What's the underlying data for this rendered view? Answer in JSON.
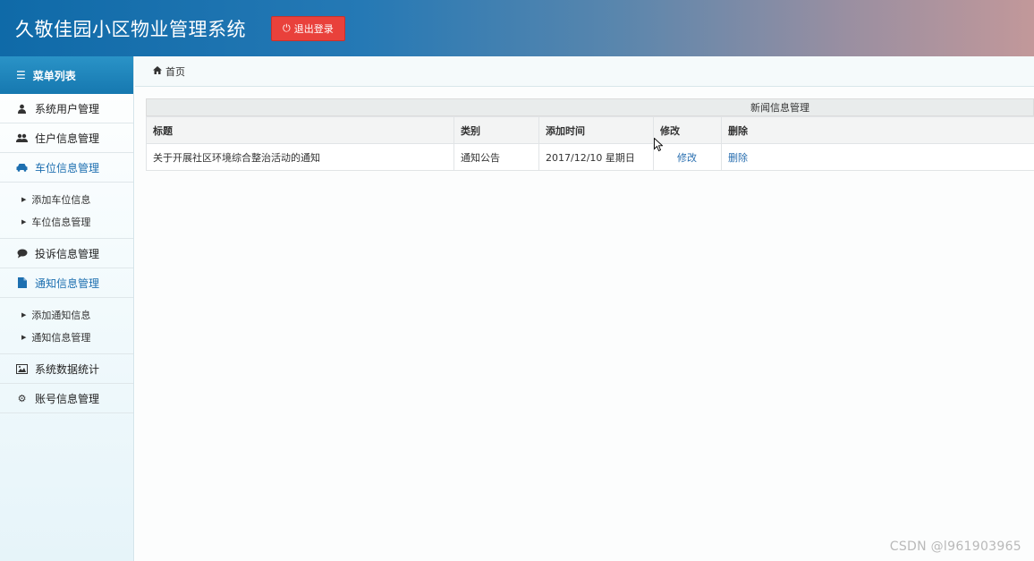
{
  "header": {
    "title": "久敬佳园小区物业管理系统",
    "logout_label": "退出登录"
  },
  "sidebar": {
    "menu_title": "菜单列表",
    "items": [
      {
        "label": "系统用户管理",
        "icon": "user-icon"
      },
      {
        "label": "住户信息管理",
        "icon": "users-icon"
      },
      {
        "label": "车位信息管理",
        "icon": "car-icon",
        "active": true
      },
      {
        "label": "投诉信息管理",
        "icon": "comment-icon"
      },
      {
        "label": "通知信息管理",
        "icon": "file-icon",
        "active": true
      },
      {
        "label": "系统数据统计",
        "icon": "picture-icon"
      },
      {
        "label": "账号信息管理",
        "icon": "gear-icon"
      }
    ],
    "parking_sub": [
      "添加车位信息",
      "车位信息管理"
    ],
    "notice_sub": [
      "添加通知信息",
      "通知信息管理"
    ]
  },
  "breadcrumb": {
    "home": "首页"
  },
  "panel": {
    "title": "新闻信息管理",
    "columns": [
      "标题",
      "类别",
      "添加时间",
      "修改",
      "删除"
    ],
    "rows": [
      {
        "title": "关于开展社区环境综合整治活动的通知",
        "category": "通知公告",
        "time": "2017/12/10 星期日",
        "edit": "修改",
        "delete": "删除"
      }
    ]
  },
  "watermark": "CSDN @l961903965",
  "colors": {
    "header_start": "#0f6aa8",
    "header_end": "#c2989a",
    "accent": "#1d6fb0",
    "logout": "#e9413b"
  }
}
